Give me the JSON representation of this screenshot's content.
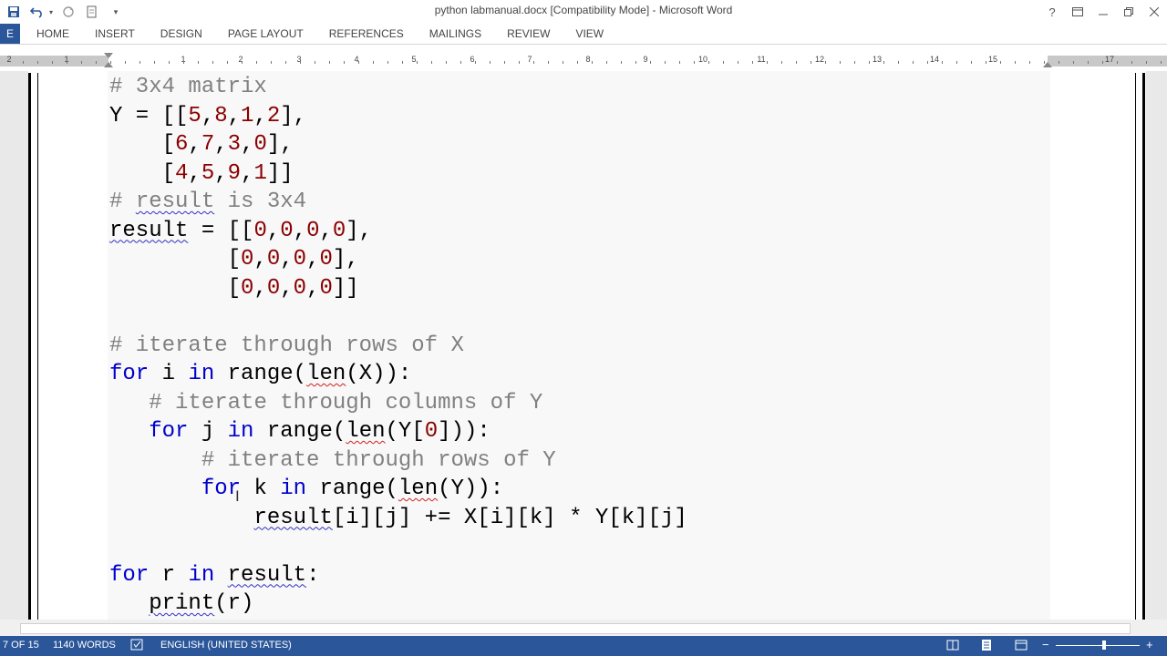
{
  "window": {
    "title": "python  labmanual.docx [Compatibility Mode] - Microsoft Word"
  },
  "ribbon": {
    "file_label": "E",
    "tabs": [
      "HOME",
      "INSERT",
      "DESIGN",
      "PAGE LAYOUT",
      "REFERENCES",
      "MAILINGS",
      "REVIEW",
      "VIEW"
    ]
  },
  "ruler": {
    "numbers": [
      "2",
      "1",
      "1",
      "2",
      "3",
      "4",
      "5",
      "6",
      "7",
      "8",
      "9",
      "10",
      "11",
      "12",
      "13",
      "14",
      "15",
      "17"
    ]
  },
  "code_lines": [
    "# 3x4 matrix",
    "Y = [[5,8,1,2],",
    "    [6,7,3,0],",
    "    [4,5,9,1]]",
    "# result is 3x4",
    "result = [[0,0,0,0],",
    "         [0,0,0,0],",
    "         [0,0,0,0]]",
    "",
    "# iterate through rows of X",
    "for i in range(len(X)):",
    "   # iterate through columns of Y",
    "   for j in range(len(Y[0])):",
    "       # iterate through rows of Y",
    "       for k in range(len(Y)):",
    "           result[i][j] += X[i][k] * Y[k][j]",
    "",
    "for r in result:",
    "   print(r)"
  ],
  "status": {
    "page": "7 OF 15",
    "words": "1140 WORDS",
    "language": "ENGLISH (UNITED STATES)"
  },
  "colors": {
    "accent": "#2b579a",
    "keyword": "#0000cc",
    "comment": "#808080",
    "number": "#8b0000"
  }
}
